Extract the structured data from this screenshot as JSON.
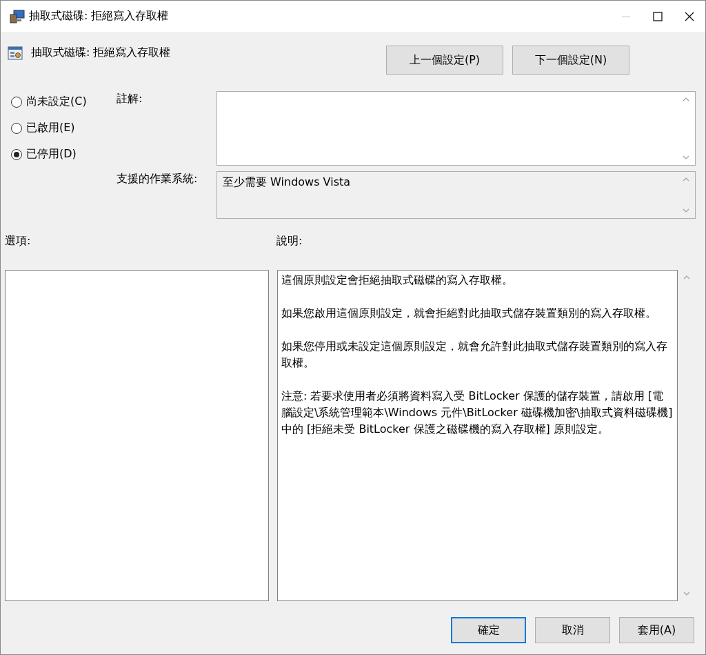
{
  "window": {
    "title": "抽取式磁碟: 拒絕寫入存取權",
    "controls": [
      {
        "kind": "minimize",
        "disabled": true
      },
      {
        "kind": "maximize",
        "disabled": false
      },
      {
        "kind": "close",
        "disabled": false
      }
    ]
  },
  "header": {
    "title": "抽取式磁碟: 拒絕寫入存取權",
    "buttons": [
      "上一個設定(P)",
      "下一個設定(N)"
    ]
  },
  "state_options": [
    {
      "label": "尚未設定(C)",
      "selected": false
    },
    {
      "label": "已啟用(E)",
      "selected": false
    },
    {
      "label": "已停用(D)",
      "selected": true
    }
  ],
  "comment": {
    "label": "註解:"
  },
  "supported_on": {
    "label": "支援的作業系統:",
    "value": "至少需要 Windows Vista"
  },
  "options": {
    "label": "選項:"
  },
  "help": {
    "label": "說明:",
    "paragraphs": [
      "這個原則設定會拒絕抽取式磁碟的寫入存取權。",
      "如果您啟用這個原則設定，就會拒絕對此抽取式儲存裝置類別的寫入存取權。",
      "如果您停用或未設定這個原則設定，就會允許對此抽取式儲存裝置類別的寫入存取權。",
      "注意: 若要求使用者必須將資料寫入受 BitLocker 保護的儲存裝置，請啟用 [電腦設定\\系統管理範本\\Windows 元件\\BitLocker 磁碟機加密\\抽取式資料磁碟機] 中的 [拒絕未受 BitLocker 保護之磁碟機的寫入存取權] 原則設定。"
    ]
  },
  "footer_buttons": [
    {
      "label": "確定",
      "kind": "default"
    },
    {
      "label": "取消",
      "kind": "normal"
    },
    {
      "label": "套用(A)",
      "kind": "normal"
    }
  ]
}
